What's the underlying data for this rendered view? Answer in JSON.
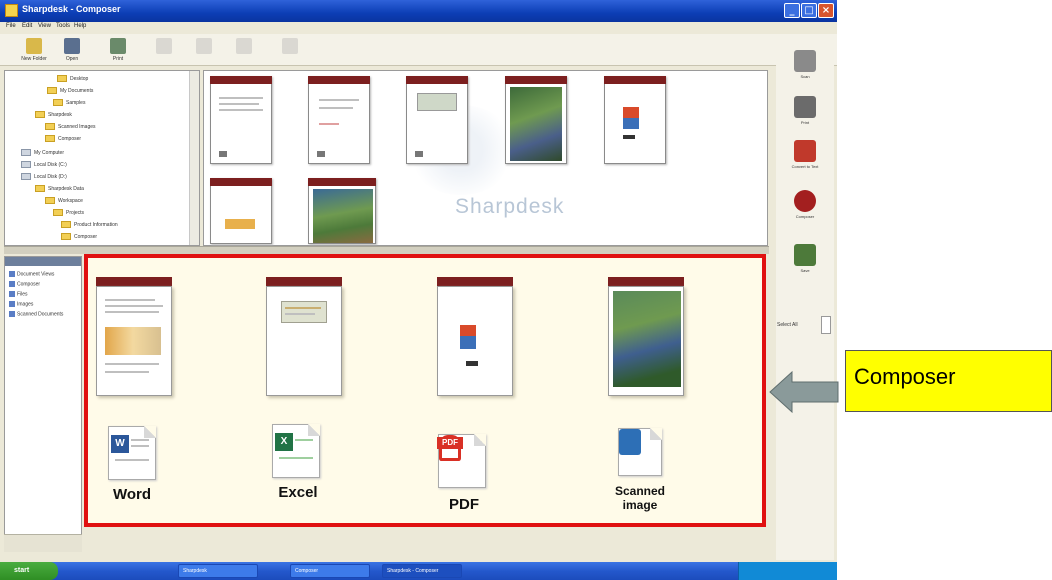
{
  "window": {
    "title": "Sharpdesk - Composer",
    "menu": [
      "File",
      "Edit",
      "View",
      "Tools",
      "Help"
    ],
    "toolbar": [
      {
        "label": "New Folder",
        "icon": "new-folder-icon"
      },
      {
        "label": "Open",
        "icon": "open-icon"
      },
      {
        "label": "Print",
        "icon": "print-icon"
      }
    ]
  },
  "folder_tree": {
    "items": [
      "Desktop",
      "My Documents",
      "Samples",
      "Sharpdesk",
      "Scanned Images",
      "Composer",
      "My Computer",
      "Local Disk (C:)",
      "Local Disk (D:)",
      "Sharpdesk Data",
      "Workspace",
      "Projects",
      "Product Information",
      "Composer"
    ]
  },
  "thumbnails": {
    "watermark": "Sharpdesk",
    "items": [
      {
        "name": "page-document",
        "kind": "doc"
      },
      {
        "name": "page-spreadsheet",
        "kind": "doc"
      },
      {
        "name": "page-report",
        "kind": "chart"
      },
      {
        "name": "page-photo",
        "kind": "photo"
      },
      {
        "name": "page-pdf",
        "kind": "pdf"
      },
      {
        "name": "page-word",
        "kind": "word"
      },
      {
        "name": "page-image",
        "kind": "photo"
      }
    ]
  },
  "left_panel": {
    "items": [
      "Document Views",
      "Composer",
      "Files",
      "Images",
      "Scanned Documents"
    ]
  },
  "composer": {
    "pages": [
      {
        "kind": "word"
      },
      {
        "kind": "excel"
      },
      {
        "kind": "pdf"
      },
      {
        "kind": "photo"
      }
    ],
    "file_types": [
      {
        "label": "Word",
        "icon": "word-document-icon",
        "badge": "W",
        "color": "#2b579a"
      },
      {
        "label": "Excel",
        "icon": "excel-document-icon",
        "badge": "X",
        "color": "#217346"
      },
      {
        "label": "PDF",
        "icon": "pdf-document-icon",
        "badge": "PDF",
        "color": "#d93025"
      },
      {
        "label": "Scanned image",
        "icon": "scanned-image-icon",
        "badge": "",
        "color": "#2d6fb6"
      }
    ]
  },
  "sidebar": {
    "items": [
      {
        "label": "Scan",
        "icon": "scanner-icon",
        "color": "#8a8a8a"
      },
      {
        "label": "Print",
        "icon": "printer-icon",
        "color": "#6b6b6b"
      },
      {
        "label": "Convert to Text",
        "icon": "convert-icon",
        "color": "#c0392b"
      },
      {
        "label": "Composer",
        "icon": "composer-icon",
        "color": "#a31f1f"
      },
      {
        "label": "Save",
        "icon": "save-icon",
        "color": "#4d7a3a"
      }
    ],
    "select_all": "Select All"
  },
  "taskbar": {
    "start": "start",
    "tasks": [
      "Sharpdesk",
      "Composer",
      "Sharpdesk - Composer"
    ],
    "clock": ""
  },
  "callout": {
    "label": "Composer"
  }
}
